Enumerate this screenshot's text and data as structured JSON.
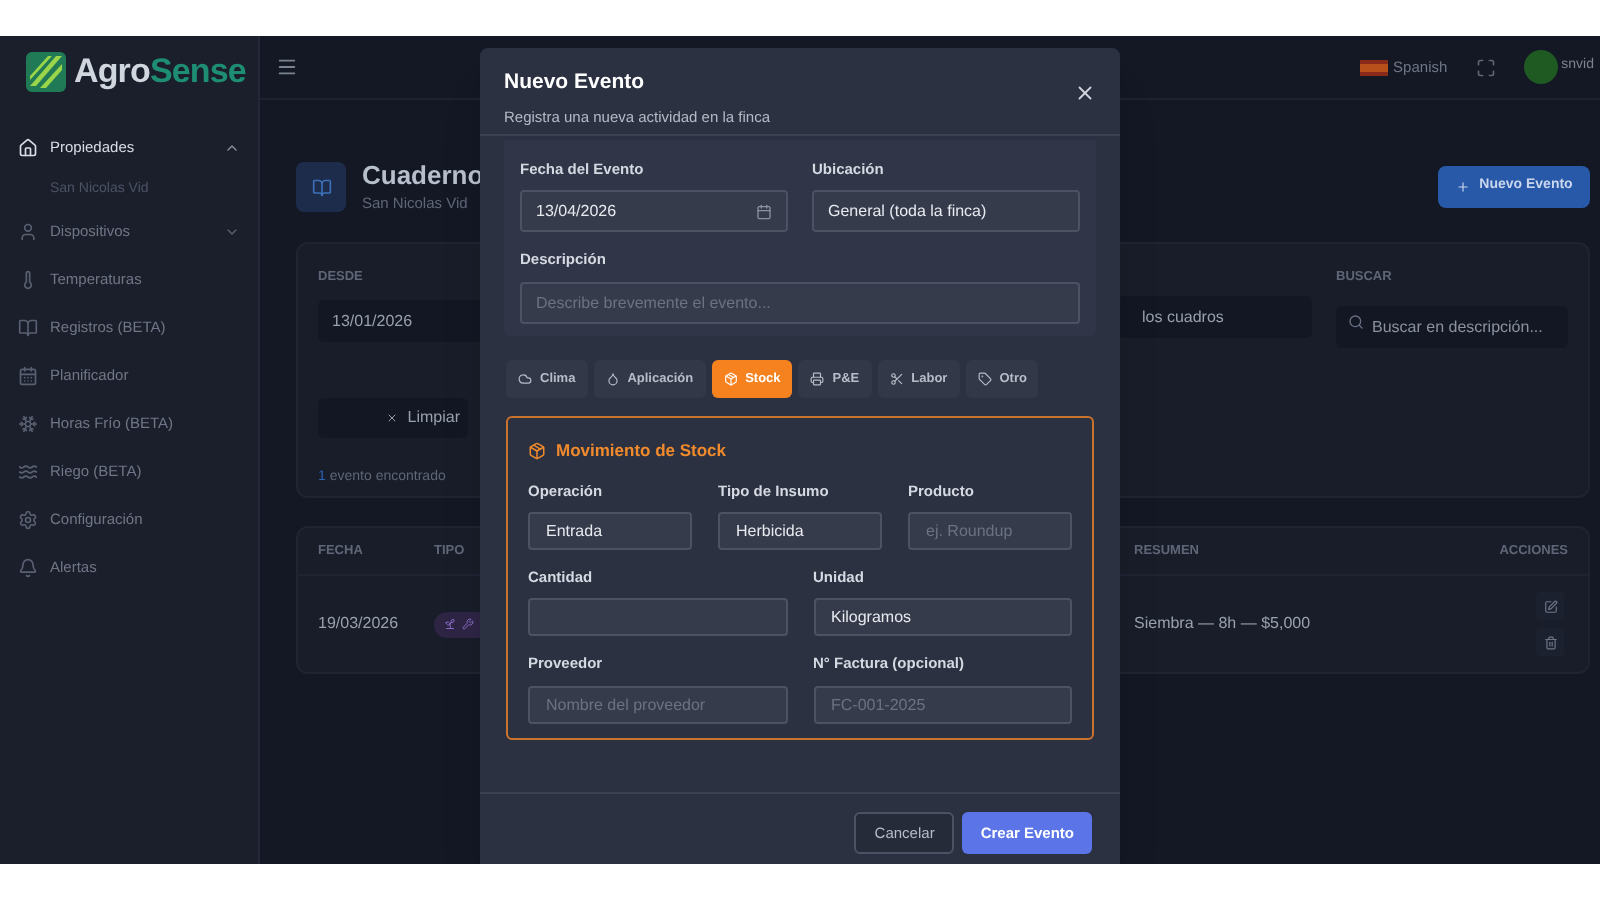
{
  "header": {
    "logo_primary": "Agro",
    "logo_secondary": "Sense",
    "language": "Spanish",
    "user": "snvid"
  },
  "sidebar": {
    "items": [
      {
        "label": "Propiedades",
        "expanded": true,
        "children": [
          {
            "label": "San Nicolas Vid"
          }
        ]
      },
      {
        "label": "Dispositivos",
        "expanded": false
      },
      {
        "label": "Temperaturas"
      },
      {
        "label": "Registros (BETA)"
      },
      {
        "label": "Planificador"
      },
      {
        "label": "Horas Frío (BETA)"
      },
      {
        "label": "Riego (BETA)"
      },
      {
        "label": "Configuración"
      },
      {
        "label": "Alertas"
      }
    ]
  },
  "page": {
    "title": "Cuaderno",
    "subtitle": "San Nicolas Vid",
    "new_button": "Nuevo Evento"
  },
  "filters": {
    "from_label": "DESDE",
    "from_value": "13/01/2026",
    "area_value": "los cuadros",
    "search_label": "BUSCAR",
    "search_placeholder": "Buscar en descripción...",
    "clear_button": "Limpiar",
    "result_count": "1",
    "result_text": "evento encontrado"
  },
  "table": {
    "columns": [
      "FECHA",
      "TIPO",
      "RESUMEN",
      "ACCIONES"
    ],
    "rows": [
      {
        "fecha": "19/03/2026",
        "resumen": "Siembra — 8h — $5,000"
      }
    ]
  },
  "modal": {
    "title": "Nuevo Evento",
    "subtitle": "Registra una nueva actividad en la finca",
    "date_label": "Fecha del Evento",
    "date_value": "13/04/2026",
    "location_label": "Ubicación",
    "location_value": "General (toda la finca)",
    "description_label": "Descripción",
    "description_placeholder": "Describe brevemente el evento...",
    "tabs": [
      {
        "label": "Clima",
        "selected": false
      },
      {
        "label": "Aplicación",
        "selected": false
      },
      {
        "label": "Stock",
        "selected": true
      },
      {
        "label": "P&E",
        "selected": false
      },
      {
        "label": "Labor",
        "selected": false
      },
      {
        "label": "Otro",
        "selected": false
      }
    ],
    "stock": {
      "title": "Movimiento de Stock",
      "row_1": [
        {
          "label": "Operación",
          "value": "Entrada"
        },
        {
          "label": "Tipo de Insumo",
          "value": "Herbicida"
        },
        {
          "label": "Producto",
          "placeholder": "ej. Roundup"
        }
      ],
      "row_2": [
        {
          "label": "Cantidad"
        },
        {
          "label": "Unidad",
          "value": "Kilogramos"
        }
      ],
      "row_3": [
        {
          "label": "Proveedor",
          "placeholder": "Nombre del proveedor"
        },
        {
          "label": "N° Factura (opcional)",
          "placeholder": "FC-001-2025"
        }
      ]
    },
    "buttons": [
      {
        "label": "Cancelar",
        "kind": "secondary"
      },
      {
        "label": "Crear Evento",
        "kind": "primary"
      }
    ]
  }
}
